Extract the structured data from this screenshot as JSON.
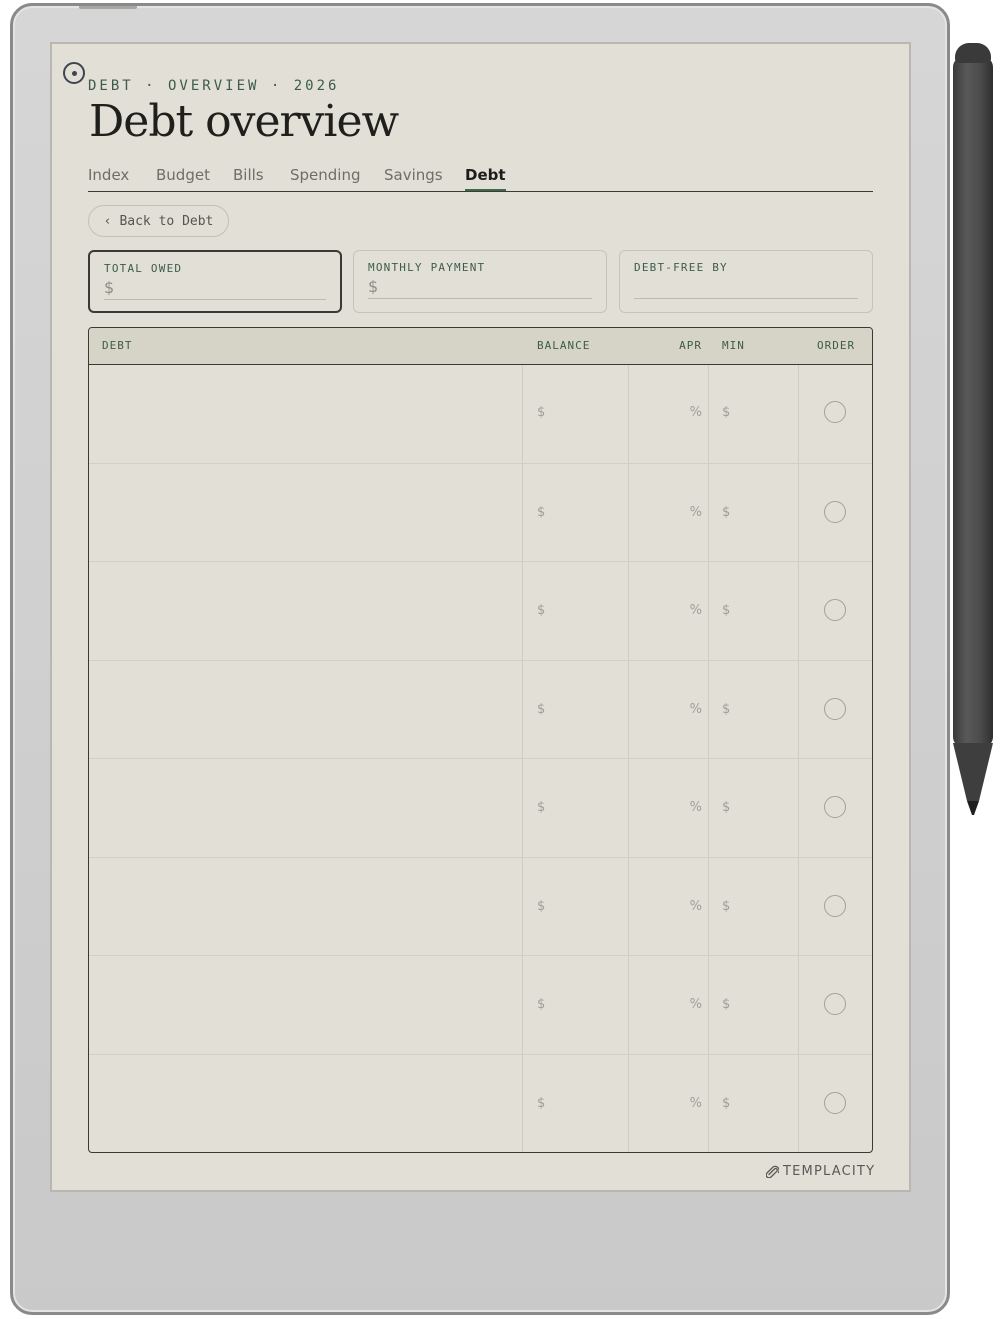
{
  "header": {
    "eyebrow": "DEBT · OVERVIEW · 2026",
    "title": "Debt overview"
  },
  "tabs": [
    {
      "label": "Index",
      "active": false
    },
    {
      "label": "Budget",
      "active": false
    },
    {
      "label": "Bills",
      "active": false
    },
    {
      "label": "Spending",
      "active": false
    },
    {
      "label": "Savings",
      "active": false
    },
    {
      "label": "Debt",
      "active": true
    }
  ],
  "back_button": {
    "chevron": "‹",
    "label": "Back to Debt"
  },
  "stats": [
    {
      "label": "TOTAL OWED",
      "prefix": "$"
    },
    {
      "label": "MONTHLY PAYMENT",
      "prefix": "$"
    },
    {
      "label": "DEBT-FREE BY",
      "prefix": ""
    }
  ],
  "table": {
    "columns": [
      "DEBT",
      "BALANCE",
      "APR",
      "MIN",
      "ORDER"
    ],
    "rows": [
      {
        "debt": "",
        "balance": "$",
        "apr": "%",
        "min": "$"
      },
      {
        "debt": "",
        "balance": "$",
        "apr": "%",
        "min": "$"
      },
      {
        "debt": "",
        "balance": "$",
        "apr": "%",
        "min": "$"
      },
      {
        "debt": "",
        "balance": "$",
        "apr": "%",
        "min": "$"
      },
      {
        "debt": "",
        "balance": "$",
        "apr": "%",
        "min": "$"
      },
      {
        "debt": "",
        "balance": "$",
        "apr": "%",
        "min": "$"
      },
      {
        "debt": "",
        "balance": "$",
        "apr": "%",
        "min": "$"
      },
      {
        "debt": "",
        "balance": "$",
        "apr": "%",
        "min": "$"
      }
    ]
  },
  "brand": {
    "name": "TEMPLACITY",
    "icon": "paperclip-icon"
  },
  "colors": {
    "accent_green": "#3d5c49",
    "screen_bg": "#e2dfd7",
    "header_bg": "#d6d4c6",
    "ink": "#1f1f1c"
  }
}
